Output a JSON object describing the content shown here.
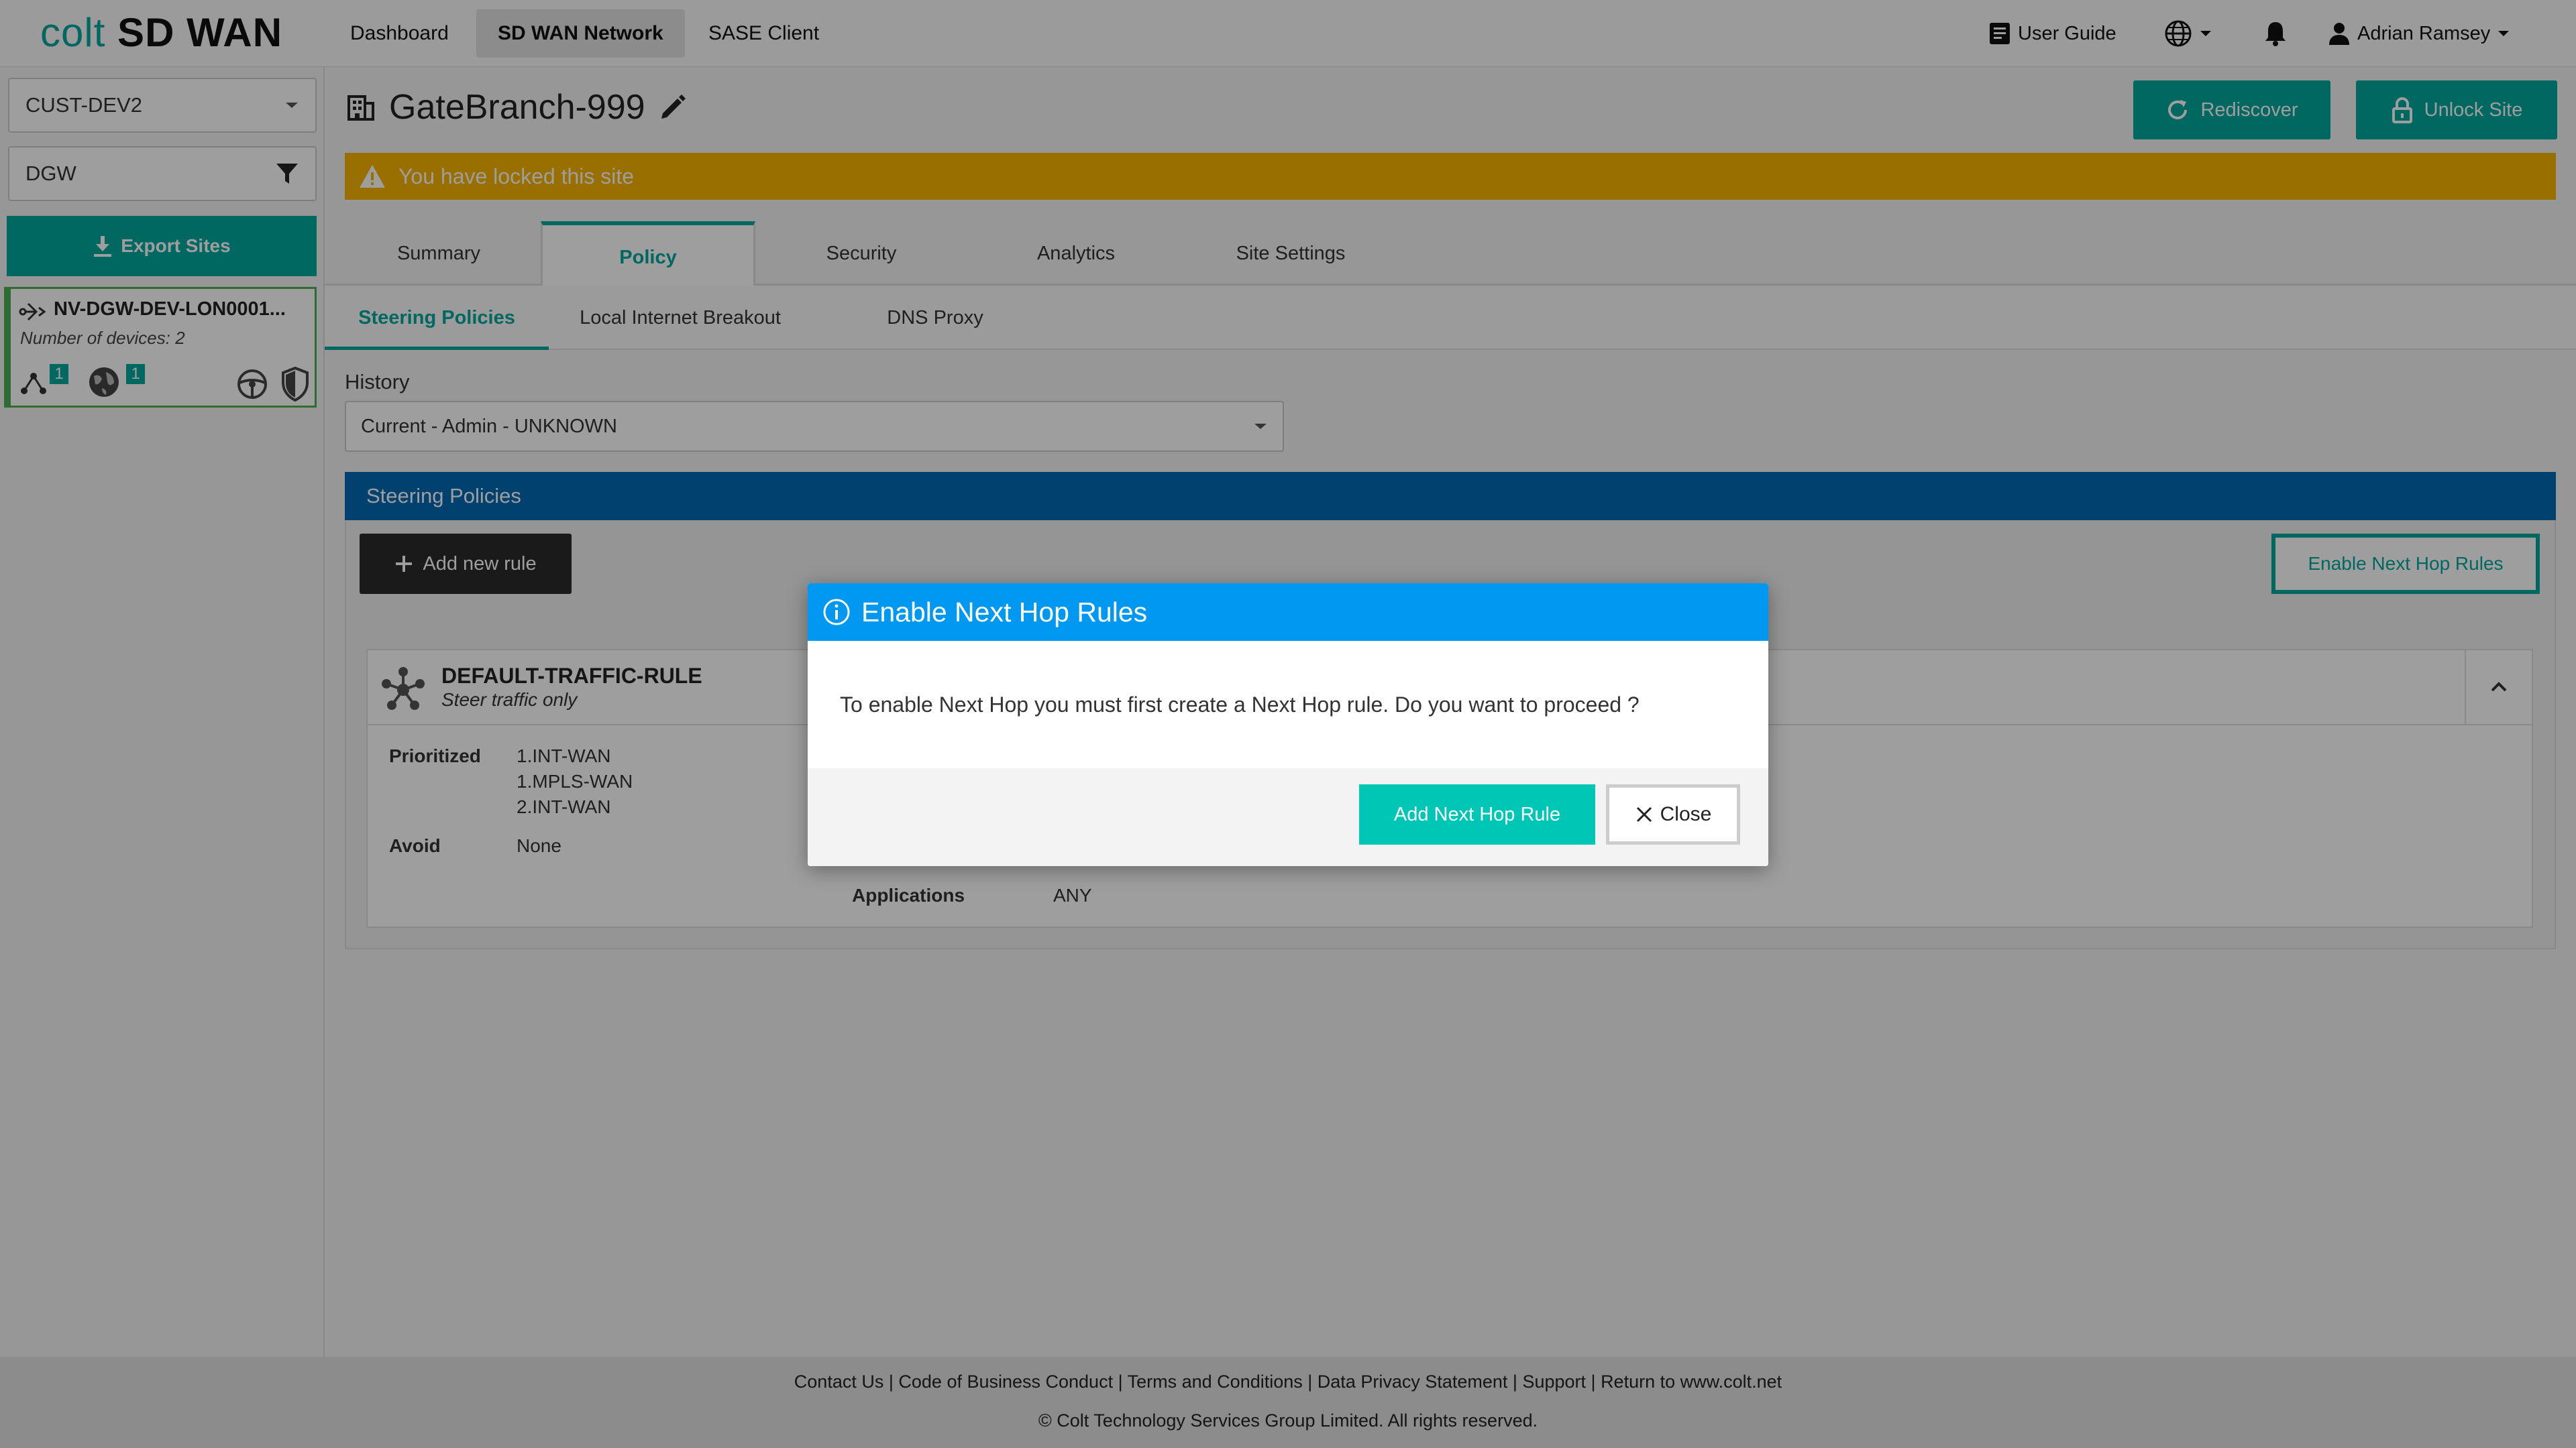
{
  "brand": {
    "logo_colt": "colt",
    "logo_product": "SD WAN"
  },
  "nav": {
    "items": [
      "Dashboard",
      "SD WAN Network",
      "SASE Client"
    ]
  },
  "header_right": {
    "user_guide": "User Guide",
    "user_name": "Adrian Ramsey"
  },
  "sidebar": {
    "customer_select": "CUST-DEV2",
    "filter_select": "DGW",
    "export_label": "Export Sites",
    "site": {
      "name": "NV-DGW-DEV-LON0001...",
      "devices": "Number of devices: 2",
      "badge_a": "1",
      "badge_b": "1"
    }
  },
  "site": {
    "title": "GateBranch-999",
    "lock_message": "You have locked this site"
  },
  "actions": {
    "rediscover": "Rediscover",
    "unlock": "Unlock Site"
  },
  "tabs": [
    "Summary",
    "Policy",
    "Security",
    "Analytics",
    "Site Settings"
  ],
  "subtabs": [
    "Steering Policies",
    "Local Internet Breakout",
    "DNS Proxy"
  ],
  "history": {
    "label": "History",
    "value": "Current - Admin - UNKNOWN"
  },
  "steering": {
    "section_title": "Steering Policies",
    "add_rule": "Add new rule",
    "enable_next_hop": "Enable Next Hop Rules",
    "rule": {
      "name": "DEFAULT-TRAFFIC-RULE",
      "subtitle": "Steer traffic only",
      "prioritized_label": "Prioritized",
      "prioritized_values": [
        "1.INT-WAN",
        "1.MPLS-WAN",
        "2.INT-WAN"
      ],
      "avoid_label": "Avoid",
      "avoid_value": "None",
      "applications_label": "Applications",
      "applications_value": "ANY"
    }
  },
  "modal": {
    "title": "Enable Next Hop Rules",
    "message": "To enable Next Hop you must first create a Next Hop rule. Do you want to proceed ?",
    "primary": "Add Next Hop Rule",
    "close": "Close"
  },
  "footer": {
    "links": [
      "Contact Us",
      "Code of Business Conduct",
      "Terms and Conditions",
      "Data Privacy Statement",
      "Support",
      "Return to www.colt.net"
    ],
    "copyright": "© Colt Technology Services Group Limited. All rights reserved."
  }
}
